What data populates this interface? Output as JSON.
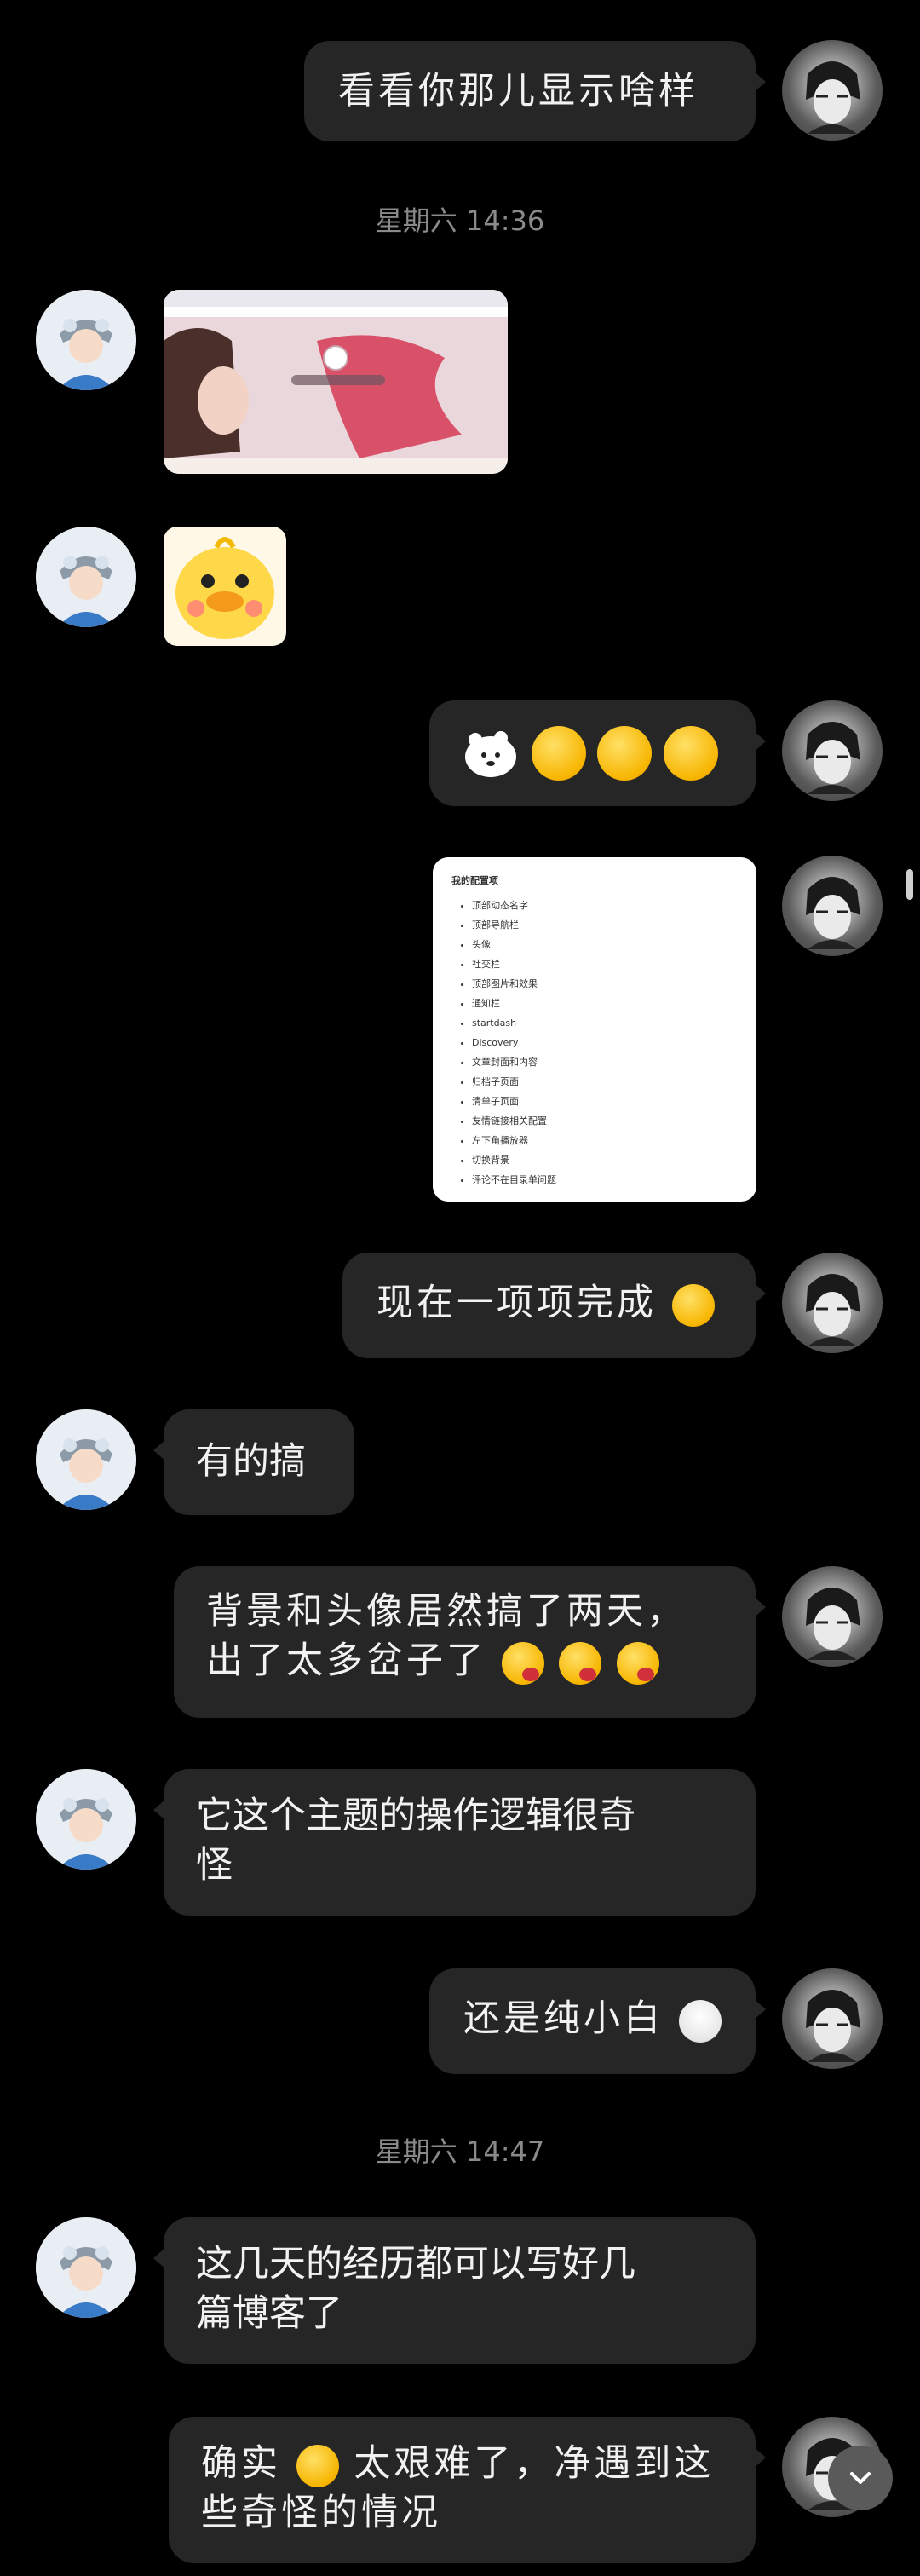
{
  "messages": {
    "m1": "看看你那儿显示啥样",
    "ts1": "星期六 14:36",
    "m6": "现在一项项完成",
    "m7": "有的搞",
    "m8_line1": "背景和头像居然搞了两天，",
    "m8_line2": "出了太多岔子了",
    "m9_line1": "它这个主题的操作逻辑很奇",
    "m9_line2": "怪",
    "m10": "还是纯小白",
    "ts2": "星期六 14:47",
    "m11_line1": "这几天的经历都可以写好几",
    "m11_line2": "篇博客了",
    "m12_line1_a": "确实",
    "m12_line1_b": "太艰难了，净遇到这",
    "m12_line2": "些奇怪的情况"
  },
  "screenshot_card": {
    "title": "我的配置项",
    "items": [
      "顶部动态名字",
      "顶部导航栏",
      "头像",
      "社交栏",
      "顶部图片和效果",
      "通知栏",
      "startdash",
      "Discovery",
      "文章封面和内容",
      "归档子页面",
      "清单子页面",
      "友情链接相关配置",
      "左下角播放器",
      "切换背景",
      "评论不在目录单问题"
    ]
  },
  "colors": {
    "background": "#000000",
    "bubble": "#262626",
    "text": "#f2f2f2",
    "timestamp": "#8a8a8a"
  },
  "icons": {
    "scroll_down": "chevron-down-icon"
  }
}
